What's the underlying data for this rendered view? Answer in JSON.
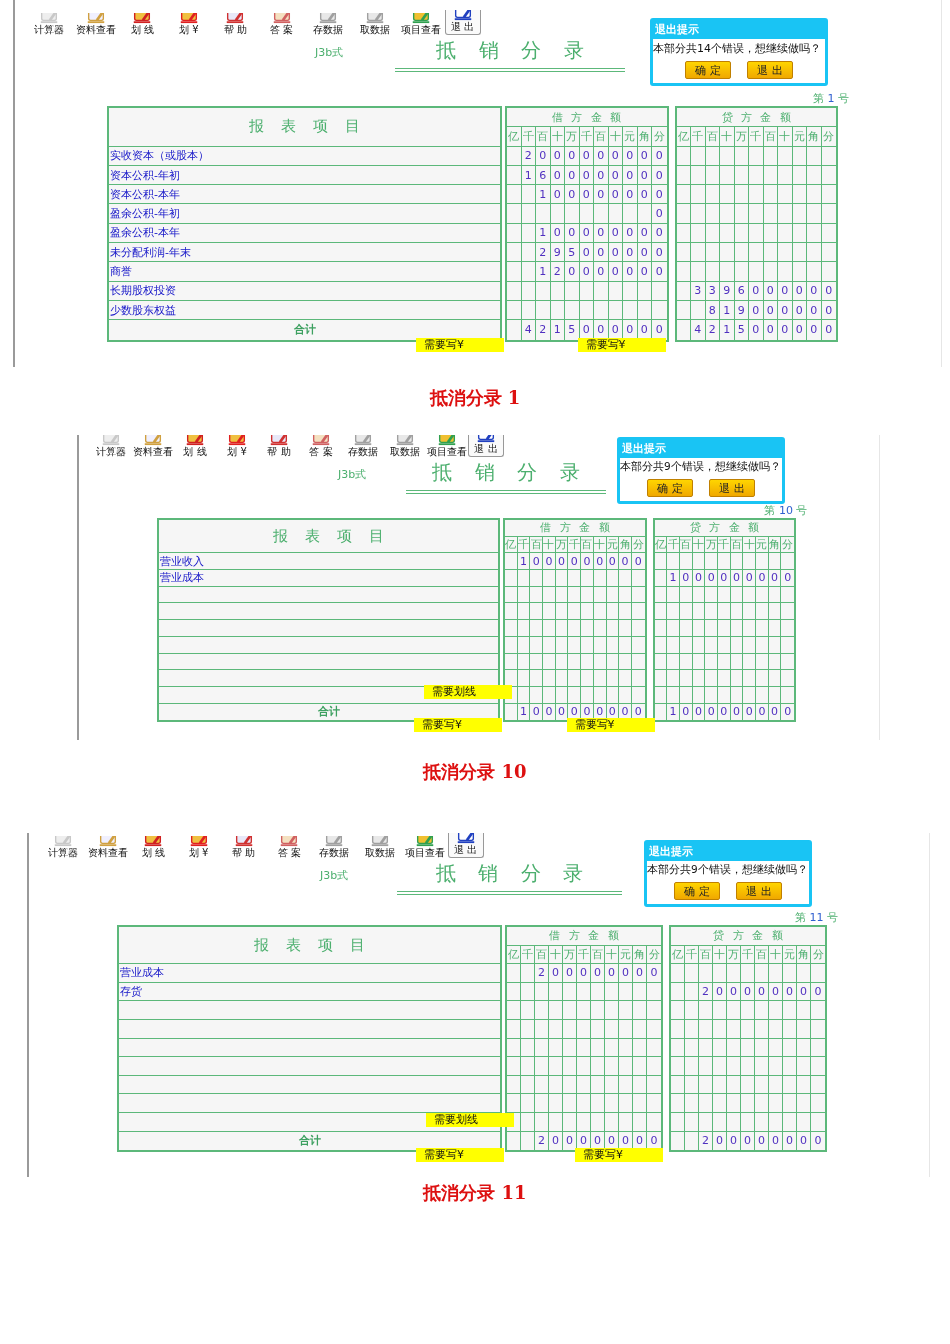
{
  "panels": [
    {
      "toolbar": [
        "计算器",
        "资料查看",
        "划 线",
        "划 ¥",
        "帮 助",
        "答 案",
        "存数据",
        "取数据",
        "项目查看",
        "退 出"
      ],
      "form_code": "J3b式",
      "title": "抵 销 分 录",
      "number": {
        "prefix": "第",
        "value": "1",
        "suffix": "号"
      },
      "table": {
        "item_header": "报 表 项 目",
        "debit_header": "借 方 金 额",
        "credit_header": "贷 方 金 额",
        "debit_units": [
          "亿",
          "千",
          "百",
          "十",
          "万",
          "千",
          "百",
          "十",
          "元",
          "角",
          "分"
        ],
        "credit_units": [
          "亿",
          "千",
          "百",
          "十",
          "万",
          "千",
          "百",
          "十",
          "元",
          "角",
          "分"
        ],
        "rows": [
          {
            "item": "实收资本（或股本）",
            "debit": "2 0 0 0 0 0 0 0 0 0"
          },
          {
            "item": "资本公积-年初",
            "debit": "1 6 0 0 0 0 0 0 0 0"
          },
          {
            "item": "资本公积-本年",
            "debit": "1 0 0 0 0 0 0 0 0"
          },
          {
            "item": "盈余公积-年初",
            "debit": "0"
          },
          {
            "item": "盈余公积-本年",
            "debit": "1 0 0 0 0 0 0 0 0"
          },
          {
            "item": "未分配利润-年末",
            "debit": "2 9 5 0 0 0 0 0 0"
          },
          {
            "item": "商誉",
            "debit": "1 2 0 0 0 0 0 0 0"
          },
          {
            "item": "长期股权投资",
            "credit": "3 3 9 6 0 0 0 0 0 0"
          },
          {
            "item": "少数股东权益",
            "credit": "8 1 9 0 0 0 0 0 0"
          }
        ],
        "total": {
          "label": "合计",
          "debit": "4 2 1 5 0 0 0 0 0 0",
          "credit": "4 2 1 5 0 0 0 0 0 0"
        }
      },
      "notes": {
        "total_item": "需要写¥",
        "total_debit": "需要写¥"
      },
      "dialog": {
        "title": "退出提示",
        "message": "本部分共14个错误，想继续做吗？",
        "buttons": [
          "确 定",
          "退 出"
        ]
      },
      "caption": "抵消分录 1"
    },
    {
      "toolbar": [
        "计算器",
        "资料查看",
        "划 线",
        "划 ¥",
        "帮 助",
        "答 案",
        "存数据",
        "取数据",
        "项目查看",
        "退 出"
      ],
      "form_code": "J3b式",
      "title": "抵 销 分 录",
      "number": {
        "prefix": "第",
        "value": "10",
        "suffix": "号"
      },
      "table": {
        "item_header": "报 表 项 目",
        "debit_header": "借 方 金 额",
        "credit_header": "贷 方 金 额",
        "debit_units": [
          "亿",
          "千",
          "百",
          "十",
          "万",
          "千",
          "百",
          "十",
          "元",
          "角",
          "分"
        ],
        "credit_units": [
          "亿",
          "千",
          "百",
          "十",
          "万",
          "千",
          "百",
          "十",
          "元",
          "角",
          "分"
        ],
        "rows": [
          {
            "item": "营业收入",
            "debit": "1 0 0 0 0 0 0 0 0 0"
          },
          {
            "item": "营业成本",
            "credit": "1 0 0 0 0 0 0 0 0 0"
          }
        ],
        "total": {
          "label": "合计",
          "debit": "1 0 0 0 0 0 0 0 0 0",
          "credit": "1 0 0 0 0 0 0 0 0 0"
        }
      },
      "notes": {
        "strike": "需要划线",
        "total_item": "需要写¥",
        "total_debit": "需要写¥"
      },
      "dialog": {
        "title": "退出提示",
        "message": "本部分共9个错误，想继续做吗？",
        "buttons": [
          "确 定",
          "退 出"
        ]
      },
      "caption": "抵消分录 10"
    },
    {
      "toolbar": [
        "计算器",
        "资料查看",
        "划 线",
        "划 ¥",
        "帮 助",
        "答 案",
        "存数据",
        "取数据",
        "项目查看",
        "退 出"
      ],
      "form_code": "J3b式",
      "title": "抵 销 分 录",
      "number": {
        "prefix": "第",
        "value": "11",
        "suffix": "号"
      },
      "table": {
        "item_header": "报 表 项 目",
        "debit_header": "借 方 金 额",
        "credit_header": "贷 方 金 额",
        "debit_units": [
          "亿",
          "千",
          "百",
          "十",
          "万",
          "千",
          "百",
          "十",
          "元",
          "角",
          "分"
        ],
        "credit_units": [
          "亿",
          "千",
          "百",
          "十",
          "万",
          "千",
          "百",
          "十",
          "元",
          "角",
          "分"
        ],
        "rows": [
          {
            "item": "营业成本",
            "debit": "2 0 0 0 0 0 0 0 0"
          },
          {
            "item": "存货",
            "credit": "2 0 0 0 0 0 0 0 0"
          }
        ],
        "total": {
          "label": "合计",
          "debit": "2 0 0 0 0 0 0 0 0",
          "credit": "2 0 0 0 0 0 0 0 0"
        }
      },
      "notes": {
        "strike": "需要划线",
        "total_item": "需要写¥",
        "total_debit": "需要写¥"
      },
      "dialog": {
        "title": "退出提示",
        "message": "本部分共9个错误，想继续做吗？",
        "buttons": [
          "确 定",
          "退 出"
        ]
      },
      "caption": "抵消分录 11"
    }
  ]
}
